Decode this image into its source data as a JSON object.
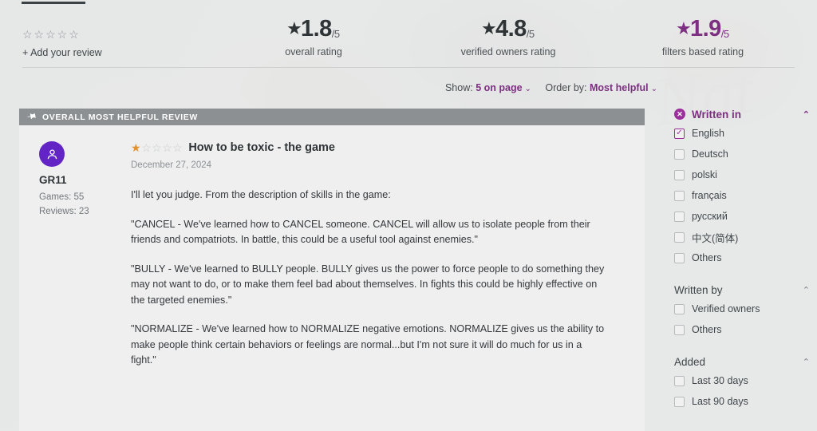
{
  "ratings": {
    "add_review": {
      "stars": "☆☆☆☆☆",
      "link_label": "+ Add your review"
    },
    "cells": [
      {
        "star": "★",
        "value": "1.8",
        "denominator": "/5",
        "caption": "overall rating",
        "accent": "#2f3437"
      },
      {
        "star": "★",
        "value": "4.8",
        "denominator": "/5",
        "caption": "verified owners rating",
        "accent": "#2f3437"
      },
      {
        "star": "★",
        "value": "1.9",
        "denominator": "/5",
        "caption": "filters based rating",
        "accent": "#7d2f82"
      }
    ]
  },
  "toolbar": {
    "show_label": "Show:",
    "show_value": "5 on page",
    "order_label": "Order by:",
    "order_value": "Most helpful",
    "chevron": "⌄"
  },
  "review_card": {
    "header": {
      "pin_icon": "✐",
      "label": "OVERALL MOST HELPFUL REVIEW"
    },
    "reviewer": {
      "name": "GR11",
      "games": "Games: 55",
      "reviews": "Reviews: 23"
    },
    "rating_filled": 1,
    "rating_total": 5,
    "title": "How to be toxic - the game",
    "date": "December 27, 2024",
    "paragraphs": [
      "I'll let you judge. From the description of skills in the game:",
      "\"CANCEL - We've learned how to CANCEL someone. CANCEL will allow us to isolate people from their friends and compatriots. In battle, this could be a useful tool against enemies.\"",
      "\"BULLY - We've learned to BULLY people. BULLY gives us the power to force people to do something they may not want to do, or to make them feel bad about themselves. In fights this could be highly effective on the targeted enemies.\"",
      "\"NORMALIZE - We've learned how to NORMALIZE negative emotions. NORMALIZE gives us the ability to make people think certain behaviors or feelings are normal...but I'm not sure it will do much for us in a fight.\""
    ]
  },
  "sidebar": {
    "groups": [
      {
        "title": "Written in",
        "accent": true,
        "clear_icon": "✕",
        "caret": "⌃",
        "items": [
          {
            "label": "English",
            "checked": true
          },
          {
            "label": "Deutsch",
            "checked": false
          },
          {
            "label": "polski",
            "checked": false
          },
          {
            "label": "français",
            "checked": false
          },
          {
            "label": "русский",
            "checked": false
          },
          {
            "label": "中文(简体)",
            "checked": false
          },
          {
            "label": "Others",
            "checked": false
          }
        ]
      },
      {
        "title": "Written by",
        "accent": false,
        "caret": "⌃",
        "items": [
          {
            "label": "Verified owners",
            "checked": false
          },
          {
            "label": "Others",
            "checked": false
          }
        ]
      },
      {
        "title": "Added",
        "accent": false,
        "caret": "⌃",
        "items": [
          {
            "label": "Last 30 days",
            "checked": false
          },
          {
            "label": "Last 90 days",
            "checked": false
          }
        ]
      }
    ]
  },
  "background": {
    "signature_text": "Nat"
  },
  "colors": {
    "purple_accent": "#7d2f82",
    "avatar_purple": "#6324c6",
    "star_gold": "#e2912f",
    "header_gray": "#8c9093",
    "page_bg": "#e6e9ea"
  }
}
